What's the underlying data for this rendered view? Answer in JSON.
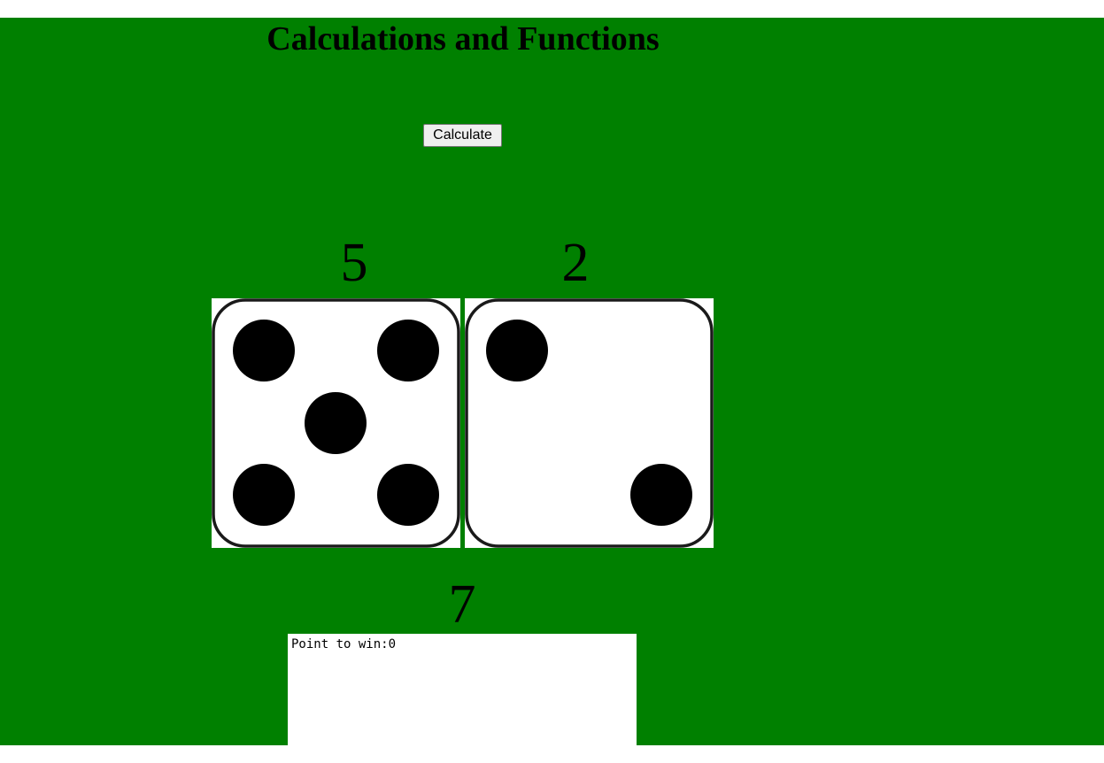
{
  "title": "Calculations and Functions",
  "calculate_button": "Calculate",
  "dice": {
    "die1": {
      "value": "5",
      "pips": 5
    },
    "die2": {
      "value": "2",
      "pips": 2
    }
  },
  "total": "7",
  "output": {
    "text": "Point to win:0"
  },
  "colors": {
    "table_background": "#008000",
    "die_face": "#ffffff",
    "pip": "#000000"
  }
}
